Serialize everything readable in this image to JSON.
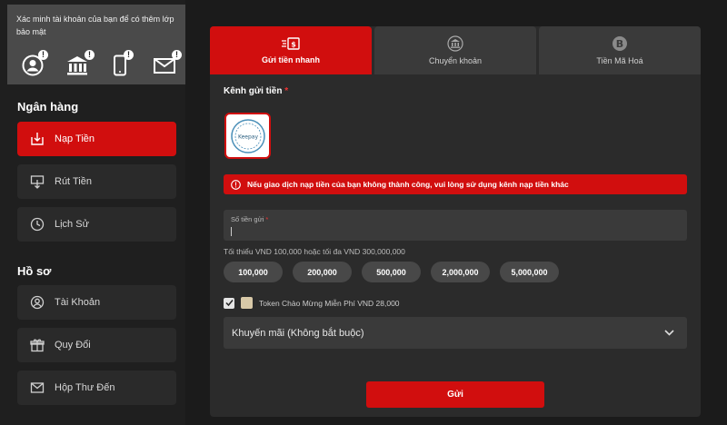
{
  "verify": {
    "text": "Xác minh tài khoản của bạn để có thêm lớp bảo mật",
    "icons": [
      {
        "name": "user-icon",
        "badge": "!"
      },
      {
        "name": "bank-icon",
        "badge": "!"
      },
      {
        "name": "phone-icon",
        "badge": "!"
      },
      {
        "name": "mail-icon",
        "badge": "!"
      }
    ]
  },
  "sidebar": {
    "bank_title": "Ngân hàng",
    "profile_title": "Hồ sơ",
    "items": [
      {
        "label": "Nạp Tiền",
        "icon": "deposit-icon",
        "active": true
      },
      {
        "label": "Rút Tiền",
        "icon": "withdraw-icon"
      },
      {
        "label": "Lịch Sử",
        "icon": "clock-icon"
      },
      {
        "label": "Tài Khoản",
        "icon": "user-icon"
      },
      {
        "label": "Quy Đổi",
        "icon": "gift-icon"
      },
      {
        "label": "Hộp Thư Đến",
        "icon": "mail-icon"
      }
    ]
  },
  "tabs": [
    {
      "label": "Gửi tiền nhanh",
      "icon": "fast-money-icon",
      "active": true
    },
    {
      "label": "Chuyển khoản",
      "icon": "bank-transfer-icon"
    },
    {
      "label": "Tiền Mã Hoá",
      "icon": "bitcoin-icon"
    }
  ],
  "form": {
    "channel_label": "Kênh gửi tiền",
    "required_mark": "*",
    "channel_logo_text": "Keepay",
    "alert": "Nếu giao dịch nạp tiền của bạn không thành công, vui lòng sử dụng kênh nạp tiền khác",
    "amount_placeholder": "Số tiền gửi",
    "limit_text": "Tối thiểu VND 100,000 hoặc tối đa VND 300,000,000",
    "chips": [
      "100,000",
      "200,000",
      "500,000",
      "2,000,000",
      "5,000,000"
    ],
    "token_text": "Token Chào Mừng Miễn Phí VND 28,000",
    "token_checked": true,
    "promo": "Khuyến mãi (Không bắt buộc)",
    "submit": "Gửi"
  },
  "colors": {
    "accent": "#d10e0e",
    "panel": "#2b2b2b",
    "field": "#3a3a3a"
  }
}
